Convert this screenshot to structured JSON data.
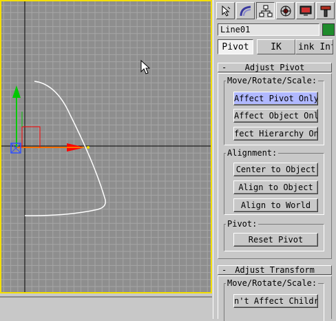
{
  "viewport": {
    "border_color": "#f5e000",
    "background": "#8e8e8e"
  },
  "panel": {
    "tabs": [
      {
        "name": "create",
        "icon": "cursor-arrow-icon"
      },
      {
        "name": "modify",
        "icon": "bend-curve-icon"
      },
      {
        "name": "hierarchy",
        "icon": "hierarchy-icon"
      },
      {
        "name": "motion",
        "icon": "motion-wheel-icon"
      },
      {
        "name": "display",
        "icon": "monitor-icon"
      },
      {
        "name": "utilities",
        "icon": "hammer-icon"
      }
    ],
    "object_name": "Line01",
    "object_color": "#1f8b2c",
    "subtabs": {
      "pivot": "Pivot",
      "ik": "IK",
      "link_info": ".ink Inf"
    },
    "adjust_pivot": {
      "sign": "-",
      "title": "Adjust Pivot",
      "move_group": "Move/Rotate/Scale:",
      "affect_pivot_only": "Affect Pivot Only",
      "affect_object_only": "Affect Object Only",
      "affect_hierarchy_only": "fect Hierarchy On",
      "alignment_group": "Alignment:",
      "center_to_object": "Center to Object",
      "align_to_object": "Align to Object",
      "align_to_world": "Align to World",
      "pivot_group": "Pivot:",
      "reset_pivot": "Reset Pivot"
    },
    "adjust_transform": {
      "sign": "-",
      "title": "Adjust Transform",
      "move_group": "Move/Rotate/Scale:",
      "dont_affect_children": "n't Affect Childr"
    }
  }
}
